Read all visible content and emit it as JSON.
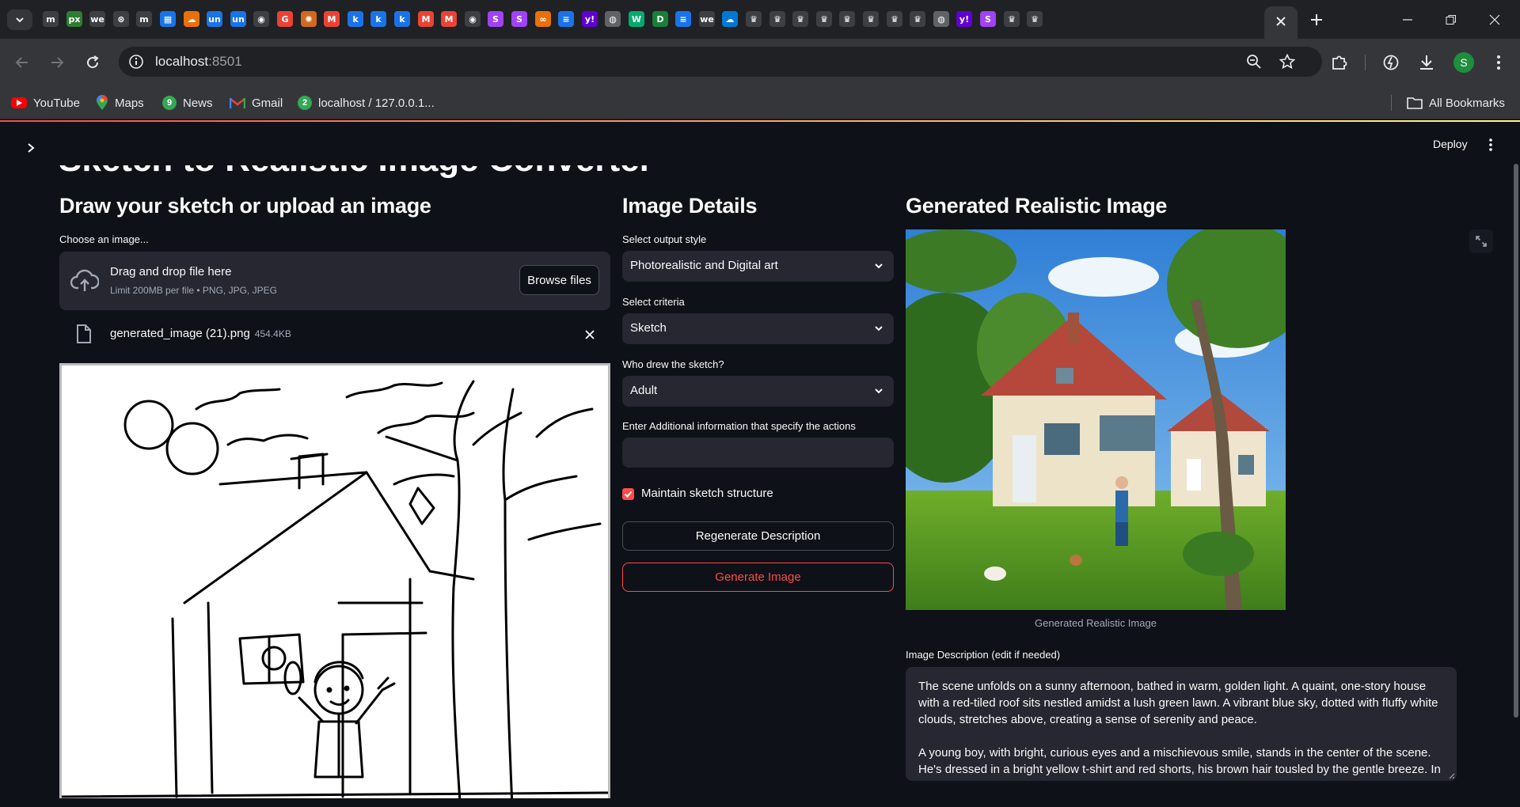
{
  "browser": {
    "tabs": [
      {
        "icon": "m-icon",
        "glyph": "m",
        "color": "#3c4043"
      },
      {
        "icon": "px-icon",
        "glyph": "px",
        "color": "#2e7d32"
      },
      {
        "icon": "we-icon",
        "glyph": "we",
        "color": "#3c4043"
      },
      {
        "icon": "openai-icon",
        "glyph": "⊛",
        "color": "#3c4043"
      },
      {
        "icon": "m-icon",
        "glyph": "m",
        "color": "#3c4043"
      },
      {
        "icon": "layout-icon",
        "glyph": "▦",
        "color": "#1a73e8"
      },
      {
        "icon": "cloud-icon",
        "glyph": "☁",
        "color": "#e8710a"
      },
      {
        "icon": "un-icon",
        "glyph": "un",
        "color": "#1a73e8"
      },
      {
        "icon": "un-icon",
        "glyph": "un",
        "color": "#1a73e8"
      },
      {
        "icon": "github-icon",
        "glyph": "◉",
        "color": "#3c4043"
      },
      {
        "icon": "google-icon",
        "glyph": "G",
        "color": "#ea4335"
      },
      {
        "icon": "spark-icon",
        "glyph": "✺",
        "color": "#d2691e"
      },
      {
        "icon": "gmail-icon",
        "glyph": "M",
        "color": "#ea4335"
      },
      {
        "icon": "k-icon",
        "glyph": "k",
        "color": "#1a73e8"
      },
      {
        "icon": "k-icon",
        "glyph": "k",
        "color": "#1a73e8"
      },
      {
        "icon": "k-icon",
        "glyph": "k",
        "color": "#1a73e8"
      },
      {
        "icon": "gmail-icon",
        "glyph": "M",
        "color": "#ea4335"
      },
      {
        "icon": "gmail-icon",
        "glyph": "M",
        "color": "#ea4335"
      },
      {
        "icon": "github-icon",
        "glyph": "◉",
        "color": "#3c4043"
      },
      {
        "icon": "s-icon",
        "glyph": "S",
        "color": "#a142f4"
      },
      {
        "icon": "s-icon",
        "glyph": "S",
        "color": "#a142f4"
      },
      {
        "icon": "infinity-icon",
        "glyph": "∞",
        "color": "#e8710a"
      },
      {
        "icon": "docs-icon",
        "glyph": "≡",
        "color": "#1a73e8"
      },
      {
        "icon": "yahoo-icon",
        "glyph": "y!",
        "color": "#6001d2"
      },
      {
        "icon": "globe-icon",
        "glyph": "◍",
        "color": "#5f6368"
      },
      {
        "icon": "w3-icon",
        "glyph": "W",
        "color": "#04aa6d"
      },
      {
        "icon": "d-icon",
        "glyph": "D",
        "color": "#188038"
      },
      {
        "icon": "docs-icon",
        "glyph": "≡",
        "color": "#1a73e8"
      },
      {
        "icon": "we-icon",
        "glyph": "we",
        "color": "#3c4043"
      },
      {
        "icon": "onedrive-icon",
        "glyph": "☁",
        "color": "#0078d4"
      },
      {
        "icon": "crown-icon",
        "glyph": "♛",
        "color": "#3c4043"
      },
      {
        "icon": "crown-icon",
        "glyph": "♛",
        "color": "#3c4043"
      },
      {
        "icon": "crown-icon",
        "glyph": "♛",
        "color": "#3c4043"
      },
      {
        "icon": "crown-icon",
        "glyph": "♛",
        "color": "#3c4043"
      },
      {
        "icon": "crown-icon",
        "glyph": "♛",
        "color": "#3c4043"
      },
      {
        "icon": "crown-icon",
        "glyph": "♛",
        "color": "#3c4043"
      },
      {
        "icon": "crown-icon",
        "glyph": "♛",
        "color": "#3c4043"
      },
      {
        "icon": "crown-icon",
        "glyph": "♛",
        "color": "#3c4043"
      },
      {
        "icon": "globe-icon",
        "glyph": "◍",
        "color": "#5f6368"
      },
      {
        "icon": "yahoo-icon",
        "glyph": "y!",
        "color": "#6001d2"
      },
      {
        "icon": "s-icon",
        "glyph": "S",
        "color": "#a142f4"
      },
      {
        "icon": "crown-icon",
        "glyph": "♛",
        "color": "#3c4043"
      },
      {
        "icon": "crown-icon",
        "glyph": "♛",
        "color": "#3c4043"
      }
    ],
    "address": {
      "host": "localhost",
      "port": ":8501"
    },
    "profile_initial": "S",
    "bookmarks": [
      {
        "label": "YouTube",
        "icon": "youtube-icon",
        "color": "#ff0000"
      },
      {
        "label": "Maps",
        "icon": "maps-icon",
        "color": "#34a853"
      },
      {
        "label": "News",
        "icon": "news-icon",
        "color": "#34a853"
      },
      {
        "label": "Gmail",
        "icon": "gmail-icon",
        "color": "#ea4335"
      },
      {
        "label": "localhost / 127.0.0.1...",
        "icon": "phpmyadmin-icon",
        "color": "#34a853"
      }
    ],
    "all_bookmarks": "All Bookmarks"
  },
  "app": {
    "title": "Sketch to Realistic Image Converter",
    "deploy": "Deploy",
    "left": {
      "heading": "Draw your sketch or upload an image",
      "uploader_label": "Choose an image...",
      "drop_title": "Drag and drop file here",
      "drop_sub": "Limit 200MB per file • PNG, JPG, JPEG",
      "browse": "Browse files",
      "file_name": "generated_image (21).png",
      "file_size": "454.4KB"
    },
    "middle": {
      "heading": "Image Details",
      "style_label": "Select output style",
      "style_value": "Photorealistic and Digital art",
      "criteria_label": "Select criteria",
      "criteria_value": "Sketch",
      "who_label": "Who drew the sketch?",
      "who_value": "Adult",
      "info_label": "Enter Additional information that specify the actions",
      "info_value": "",
      "maintain_label": "Maintain sketch structure",
      "maintain_checked": true,
      "regenerate": "Regenerate Description",
      "generate": "Generate Image"
    },
    "right": {
      "heading": "Generated Realistic Image",
      "caption": "Generated Realistic Image",
      "desc_label": "Image Description (edit if needed)",
      "desc_p1": "The scene unfolds on a sunny afternoon, bathed in warm, golden light. A quaint, one-story house with a red-tiled roof sits nestled amidst a lush green lawn. A vibrant blue sky, dotted with fluffy white clouds, stretches above, creating a sense of serenity and peace.",
      "desc_p2": "A young boy, with bright, curious eyes and a mischievous smile, stands in the center of the scene. He's dressed in a bright yellow t-shirt and red shorts, his brown hair tousled by the gentle breeze. In his hand,"
    }
  }
}
